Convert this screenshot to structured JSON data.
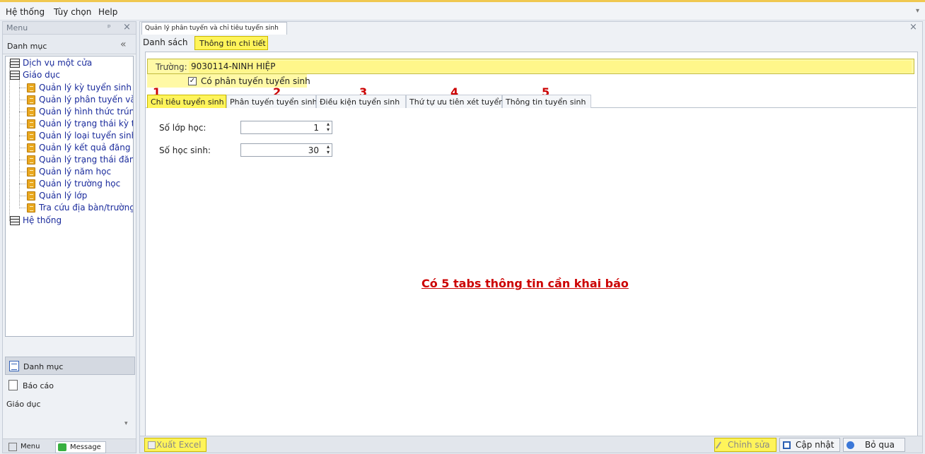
{
  "menubar": {
    "items": [
      "Hệ thống",
      "Tùy chọn",
      "Help"
    ],
    "chevron_icon": "chevron-down-icon"
  },
  "left_panel": {
    "title": "Menu",
    "pin_glyph": "ᵖ",
    "close_glyph": "×",
    "section_title": "Danh mục",
    "collapse_glyph": "«",
    "tree": {
      "root_items": [
        "Dịch vụ một cửa",
        "Giáo dục",
        "Hệ thống"
      ],
      "children": [
        "Quản lý kỳ tuyển sinh",
        "Quản lý phân tuyến và ch",
        "Quản lý hình thức trúng t",
        "Quản lý trạng thái kỳ tuyể",
        "Quản lý loại tuyển sinh",
        "Quản lý kết quả đăng ký",
        "Quản lý trạng thái đăng k",
        "Quản lý năm học",
        "Quản lý trường học",
        "Quản lý lớp",
        "Tra cứu địa bàn/trường h"
      ]
    },
    "scroll_left": "<",
    "scroll_right": ">",
    "nav": {
      "danhmuc": "Danh mục",
      "baocao": "Báo cáo",
      "giaoduc": "Giáo dục"
    },
    "bottom_tabs": {
      "menu": "Menu",
      "message": "Message"
    }
  },
  "document": {
    "tab_title": "Quản lý phân tuyến và chỉ tiêu tuyển sinh",
    "close_glyph": "×",
    "view_tabs": {
      "list": "Danh sách",
      "detail": "Thông tin chi tiết"
    },
    "truong_label": "Trường:",
    "truong_value": "9030114-NINH HIỆP",
    "checkbox_label": "Có phân tuyến tuyển sinh",
    "checkbox_checked": true,
    "tab_numbers": [
      "1",
      "2",
      "3",
      "4",
      "5"
    ],
    "info_tabs": [
      "Chỉ tiêu tuyển sinh",
      "Phân tuyến tuyển sinh",
      "Điều kiện tuyển sinh",
      "Thứ tự ưu tiên xét tuyển",
      "Thông tin tuyển sinh"
    ],
    "fields": {
      "so_lop_label": "Số lớp học:",
      "so_lop_value": "1",
      "so_hs_label": "Số học sinh:",
      "so_hs_value": "30"
    },
    "annotation": "Có 5 tabs thông tin cần khai báo",
    "buttons": {
      "excel": "Xuất Excel",
      "edit": "Chỉnh sửa",
      "update": "Cập nhật",
      "cancel": "Bỏ qua"
    }
  },
  "colors": {
    "highlight": "#fff45a",
    "annotation_red": "#cc0000",
    "tree_link": "#1a2b9c"
  }
}
